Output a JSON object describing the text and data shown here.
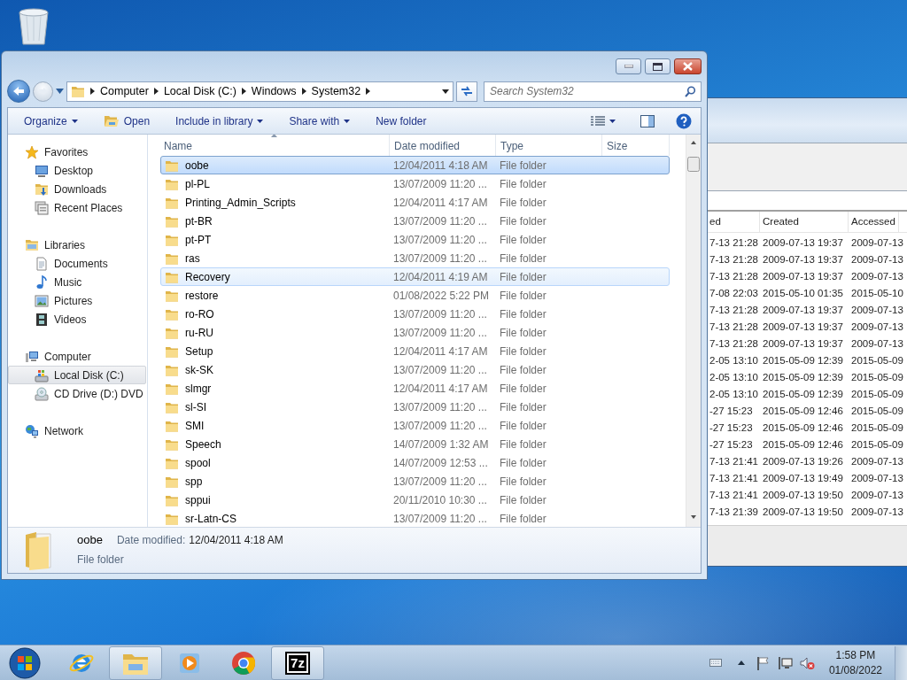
{
  "explorer": {
    "address": {
      "segments": [
        "Computer",
        "Local Disk (C:)",
        "Windows",
        "System32"
      ]
    },
    "search": {
      "placeholder": "Search System32"
    },
    "toolbar": [
      {
        "label": "Organize",
        "kind": "menu"
      },
      {
        "label": "Open",
        "kind": "open"
      },
      {
        "label": "Include in library",
        "kind": "menu"
      },
      {
        "label": "Share with",
        "kind": "menu"
      },
      {
        "label": "New folder",
        "kind": "plain"
      }
    ],
    "nav": [
      {
        "label": "Favorites",
        "kind": "star",
        "selected": false,
        "children": [
          {
            "label": "Desktop",
            "kind": "desktop",
            "selected": false
          },
          {
            "label": "Downloads",
            "kind": "downloads",
            "selected": false
          },
          {
            "label": "Recent Places",
            "kind": "recent",
            "selected": false
          }
        ]
      },
      {
        "label": "Libraries",
        "kind": "library",
        "selected": false,
        "children": [
          {
            "label": "Documents",
            "kind": "documents",
            "selected": false
          },
          {
            "label": "Music",
            "kind": "music",
            "selected": false
          },
          {
            "label": "Pictures",
            "kind": "pictures",
            "selected": false
          },
          {
            "label": "Videos",
            "kind": "videos",
            "selected": false
          }
        ]
      },
      {
        "label": "Computer",
        "kind": "computer",
        "selected": false,
        "children": [
          {
            "label": "Local Disk (C:)",
            "kind": "disk",
            "selected": true
          },
          {
            "label": "CD Drive (D:) DVD",
            "kind": "cd",
            "selected": false
          }
        ]
      },
      {
        "label": "Network",
        "kind": "network",
        "selected": false
      }
    ],
    "columns": [
      {
        "label": "Name",
        "sorted": true
      },
      {
        "label": "Date modified",
        "sorted": false
      },
      {
        "label": "Type",
        "sorted": false
      },
      {
        "label": "Size",
        "sorted": false
      }
    ],
    "rows": [
      {
        "name": "oobe",
        "date": "12/04/2011 4:18 AM",
        "type": "File folder",
        "selected": true,
        "hovered": false
      },
      {
        "name": "pl-PL",
        "date": "13/07/2009 11:20 ...",
        "type": "File folder",
        "selected": false,
        "hovered": false
      },
      {
        "name": "Printing_Admin_Scripts",
        "date": "12/04/2011 4:17 AM",
        "type": "File folder",
        "selected": false,
        "hovered": false
      },
      {
        "name": "pt-BR",
        "date": "13/07/2009 11:20 ...",
        "type": "File folder",
        "selected": false,
        "hovered": false
      },
      {
        "name": "pt-PT",
        "date": "13/07/2009 11:20 ...",
        "type": "File folder",
        "selected": false,
        "hovered": false
      },
      {
        "name": "ras",
        "date": "13/07/2009 11:20 ...",
        "type": "File folder",
        "selected": false,
        "hovered": false
      },
      {
        "name": "Recovery",
        "date": "12/04/2011 4:19 AM",
        "type": "File folder",
        "selected": false,
        "hovered": true
      },
      {
        "name": "restore",
        "date": "01/08/2022 5:22 PM",
        "type": "File folder",
        "selected": false,
        "hovered": false
      },
      {
        "name": "ro-RO",
        "date": "13/07/2009 11:20 ...",
        "type": "File folder",
        "selected": false,
        "hovered": false
      },
      {
        "name": "ru-RU",
        "date": "13/07/2009 11:20 ...",
        "type": "File folder",
        "selected": false,
        "hovered": false
      },
      {
        "name": "Setup",
        "date": "12/04/2011 4:17 AM",
        "type": "File folder",
        "selected": false,
        "hovered": false
      },
      {
        "name": "sk-SK",
        "date": "13/07/2009 11:20 ...",
        "type": "File folder",
        "selected": false,
        "hovered": false
      },
      {
        "name": "slmgr",
        "date": "12/04/2011 4:17 AM",
        "type": "File folder",
        "selected": false,
        "hovered": false
      },
      {
        "name": "sl-SI",
        "date": "13/07/2009 11:20 ...",
        "type": "File folder",
        "selected": false,
        "hovered": false
      },
      {
        "name": "SMI",
        "date": "13/07/2009 11:20 ...",
        "type": "File folder",
        "selected": false,
        "hovered": false
      },
      {
        "name": "Speech",
        "date": "14/07/2009 1:32 AM",
        "type": "File folder",
        "selected": false,
        "hovered": false
      },
      {
        "name": "spool",
        "date": "14/07/2009 12:53 ...",
        "type": "File folder",
        "selected": false,
        "hovered": false
      },
      {
        "name": "spp",
        "date": "13/07/2009 11:20 ...",
        "type": "File folder",
        "selected": false,
        "hovered": false
      },
      {
        "name": "sppui",
        "date": "20/11/2010 10:30 ...",
        "type": "File folder",
        "selected": false,
        "hovered": false
      },
      {
        "name": "sr-Latn-CS",
        "date": "13/07/2009 11:20 ...",
        "type": "File folder",
        "selected": false,
        "hovered": false
      }
    ],
    "details": {
      "name": "oobe",
      "type": "File folder",
      "date_label": "Date modified:",
      "date_value": "12/04/2011 4:18 AM"
    }
  },
  "background_window": {
    "columns": [
      "ed",
      "Created",
      "Accessed"
    ],
    "rows": [
      [
        "7-13 21:28",
        "2009-07-13 19:37",
        "2009-07-13"
      ],
      [
        "7-13 21:28",
        "2009-07-13 19:37",
        "2009-07-13"
      ],
      [
        "7-13 21:28",
        "2009-07-13 19:37",
        "2009-07-13"
      ],
      [
        "7-08 22:03",
        "2015-05-10 01:35",
        "2015-05-10"
      ],
      [
        "7-13 21:28",
        "2009-07-13 19:37",
        "2009-07-13"
      ],
      [
        "7-13 21:28",
        "2009-07-13 19:37",
        "2009-07-13"
      ],
      [
        "7-13 21:28",
        "2009-07-13 19:37",
        "2009-07-13"
      ],
      [
        "2-05 13:10",
        "2015-05-09 12:39",
        "2015-05-09"
      ],
      [
        "2-05 13:10",
        "2015-05-09 12:39",
        "2015-05-09"
      ],
      [
        "2-05 13:10",
        "2015-05-09 12:39",
        "2015-05-09"
      ],
      [
        "-27 15:23",
        "2015-05-09 12:46",
        "2015-05-09"
      ],
      [
        "-27 15:23",
        "2015-05-09 12:46",
        "2015-05-09"
      ],
      [
        "-27 15:23",
        "2015-05-09 12:46",
        "2015-05-09"
      ],
      [
        "7-13 21:41",
        "2009-07-13 19:26",
        "2009-07-13"
      ],
      [
        "7-13 21:41",
        "2009-07-13 19:49",
        "2009-07-13"
      ],
      [
        "7-13 21:41",
        "2009-07-13 19:50",
        "2009-07-13"
      ],
      [
        "7-13 21:39",
        "2009-07-13 19:50",
        "2009-07-13"
      ]
    ]
  },
  "taskbar": {
    "apps": [
      {
        "kind": "ie",
        "open": false
      },
      {
        "kind": "explorer",
        "open": true
      },
      {
        "kind": "media",
        "open": false
      },
      {
        "kind": "chrome",
        "open": false
      },
      {
        "kind": "archiver",
        "label": "7z",
        "open": true
      }
    ],
    "volume_muted": true,
    "clock": {
      "time": "1:58 PM",
      "date": "01/08/2022"
    }
  }
}
